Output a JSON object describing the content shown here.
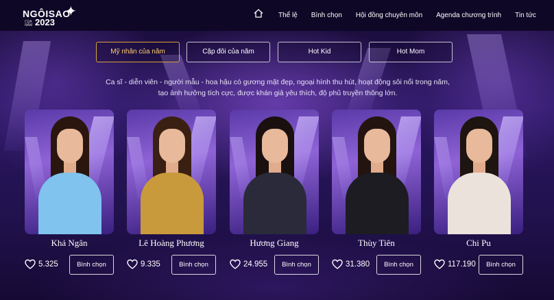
{
  "header": {
    "logo": {
      "line1": "NGÔISAO",
      "line2": "CỦA NĂM",
      "year": "2023"
    },
    "nav": [
      "Thể lệ",
      "Bình chọn",
      "Hội đồng chuyên môn",
      "Agenda chương trình",
      "Tin tức"
    ]
  },
  "tabs": [
    {
      "label": "Mỹ nhân của năm",
      "active": true
    },
    {
      "label": "Cặp đôi của năm",
      "active": false
    },
    {
      "label": "Hot Kid",
      "active": false
    },
    {
      "label": "Hot Mom",
      "active": false
    }
  ],
  "description": "Ca sĩ - diễn viên - người mẫu - hoa hậu có gương mặt đẹp, ngoại hình thu hút, hoạt động sôi nổi trong năm, tạo ảnh hưởng tích cực, được khán giả yêu thích, độ phủ truyền thông lớn.",
  "vote_label": "Bình chọn",
  "candidates": [
    {
      "name": "Khả Ngân",
      "votes": "5.325",
      "hair": "#2a160e",
      "outfit": "#7fc3ee"
    },
    {
      "name": "Lê Hoàng Phương",
      "votes": "9.335",
      "hair": "#3a2012",
      "outfit": "#c99a3c"
    },
    {
      "name": "Hương Giang",
      "votes": "24.955",
      "hair": "#1a1010",
      "outfit": "#2a2a3a"
    },
    {
      "name": "Thùy Tiên",
      "votes": "31.380",
      "hair": "#241410",
      "outfit": "#1c1c22"
    },
    {
      "name": "Chi Pu",
      "votes": "117.190",
      "hair": "#1e1410",
      "outfit": "#ece2dc"
    }
  ],
  "colors": {
    "accent": "#d8a53a",
    "background": "#1b0d3d"
  }
}
